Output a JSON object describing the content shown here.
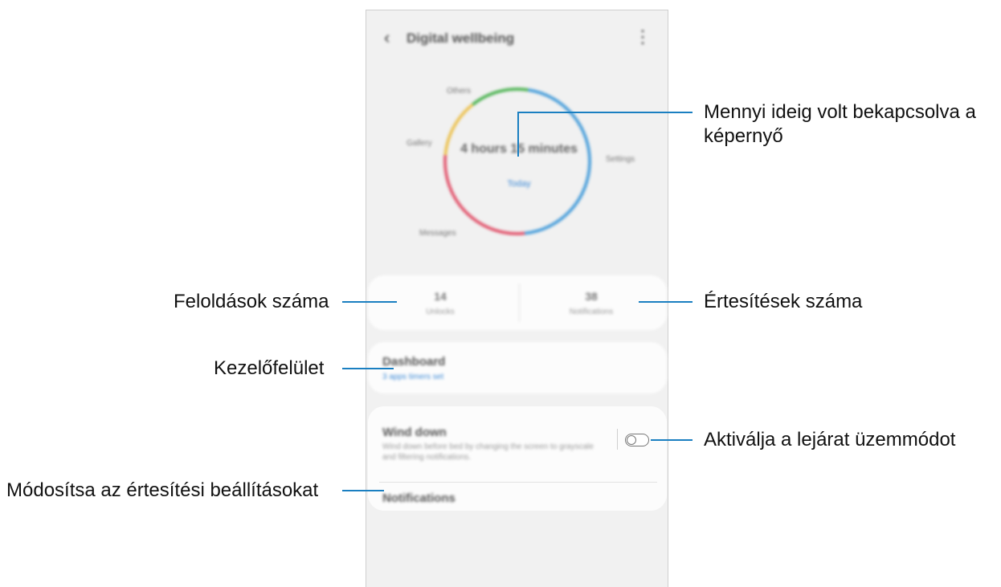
{
  "app": {
    "title": "Digital wellbeing",
    "back_icon": "chevron-left-icon",
    "more_icon": "more-vert-icon"
  },
  "chart_data": {
    "type": "pie",
    "donut": true,
    "slices": [
      {
        "label": "Settings",
        "value": 46,
        "color": "#4fa1db"
      },
      {
        "label": "Messages",
        "value": 28,
        "color": "#e25b72"
      },
      {
        "label": "Gallery",
        "value": 13,
        "color": "#ecc459"
      },
      {
        "label": "Others",
        "value": 13,
        "color": "#54b659"
      }
    ],
    "center_text": "4 hours 15 minutes",
    "center_link": "Today"
  },
  "stats": {
    "unlocks_value": "14",
    "unlocks_label": "Unlocks",
    "notifications_value": "38",
    "notifications_label": "Notifications"
  },
  "dashboard": {
    "title": "Dashboard",
    "subtitle": "3 apps timers set"
  },
  "wind_down": {
    "title": "Wind down",
    "description": "Wind down before bed by changing the screen to grayscale and filtering notifications.",
    "toggle_on": false,
    "notifications_label": "Notifications"
  },
  "annotations": {
    "screen_time": "Mennyi ideig volt bekapcsolva a képernyő",
    "unlocks": "Feloldások száma",
    "notifications": "Értesítések száma",
    "dashboard": "Kezelőfelület",
    "wind_down": "Aktiválja a lejárat üzemmódot",
    "notification_settings": "Módosítsa az értesítési beállításokat"
  }
}
